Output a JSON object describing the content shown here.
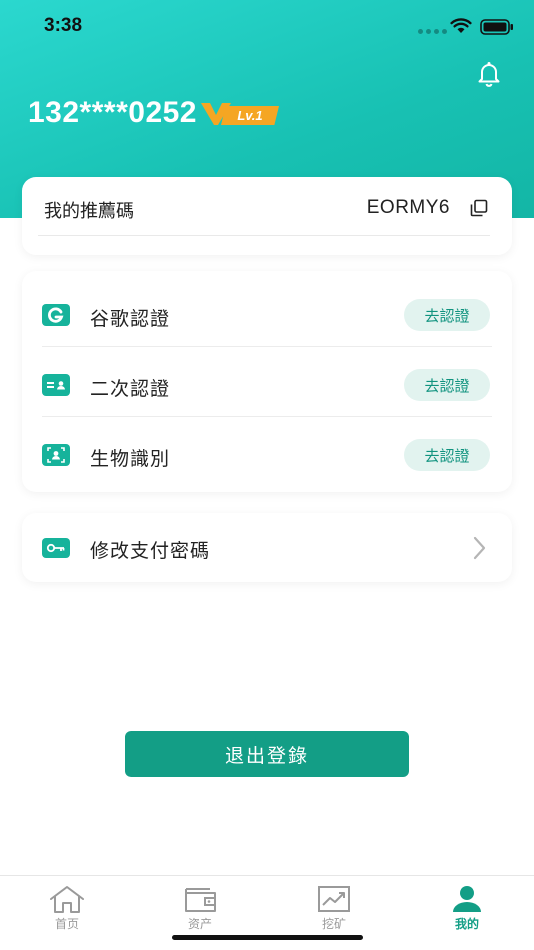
{
  "status_bar": {
    "time": "3:38"
  },
  "header": {
    "phone_number": "132****0252",
    "level_label": "Lv.1",
    "bell_icon": "bell-icon"
  },
  "referral": {
    "label": "我的推薦碼",
    "code": "EORMY6",
    "copy_icon": "copy-icon"
  },
  "verification": [
    {
      "label": "谷歌認證",
      "button": "去認證",
      "icon": "google-auth-icon"
    },
    {
      "label": "二次認證",
      "button": "去認證",
      "icon": "id-card-icon"
    },
    {
      "label": "生物識別",
      "button": "去認證",
      "icon": "face-scan-icon"
    }
  ],
  "payment_password": {
    "label": "修改支付密碼",
    "icon": "key-icon"
  },
  "logout": {
    "label": "退出登錄"
  },
  "tabbar": {
    "tabs": [
      {
        "label": "首页",
        "icon": "home-icon"
      },
      {
        "label": "资产",
        "icon": "wallet-icon"
      },
      {
        "label": "挖矿",
        "icon": "chart-icon"
      },
      {
        "label": "我的",
        "icon": "user-icon",
        "active": true
      }
    ]
  },
  "colors": {
    "header_gradient_start": "#2bd8cf",
    "header_gradient_end": "#12b3a2",
    "accent": "#139e86",
    "badge": "#f5a623"
  }
}
